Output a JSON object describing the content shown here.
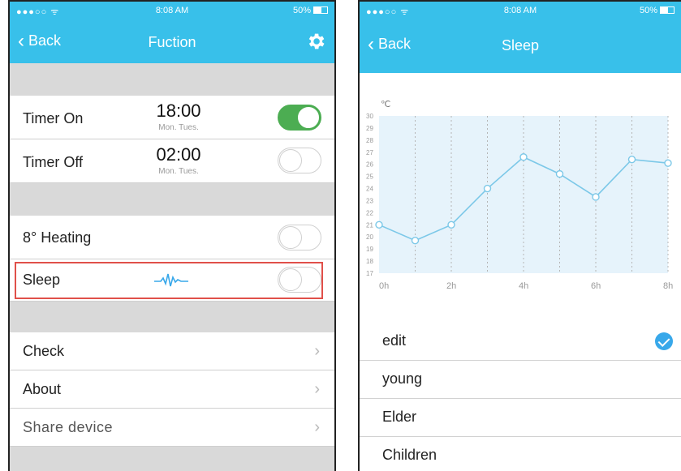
{
  "left_screen": {
    "status": {
      "signal": "●●●○○",
      "wifi": "ᯤ",
      "time": "8:08 AM",
      "battery": "50%"
    },
    "nav": {
      "back_label": "Back",
      "title": "Fuction",
      "settings_icon": "gear-icon"
    },
    "timer_on": {
      "label": "Timer On",
      "time": "18:00",
      "days": "Mon. Tues.",
      "enabled": true
    },
    "timer_off": {
      "label": "Timer Off",
      "time": "02:00",
      "days": "Mon. Tues.",
      "enabled": false
    },
    "heating": {
      "label": "8° Heating",
      "enabled": false
    },
    "sleep": {
      "label": "Sleep",
      "enabled": false,
      "wave_icon": "heartbeat-icon"
    },
    "menu": [
      {
        "label": "Check"
      },
      {
        "label": "About"
      },
      {
        "label": "Share device"
      }
    ]
  },
  "right_screen": {
    "status": {
      "signal": "●●●○○",
      "wifi": "ᯤ",
      "time": "8:08 AM",
      "battery": "50%"
    },
    "nav": {
      "back_label": "Back",
      "title": "Sleep"
    },
    "options": [
      {
        "label": "edit",
        "selected": true
      },
      {
        "label": "young",
        "selected": false
      },
      {
        "label": "Elder",
        "selected": false
      },
      {
        "label": "Children",
        "selected": false
      }
    ]
  },
  "chart_data": {
    "type": "line",
    "ylabel": "℃",
    "ylim": [
      17,
      30
    ],
    "yticks": [
      "30",
      "29",
      "28",
      "27",
      "26",
      "25",
      "24",
      "23",
      "22",
      "21",
      "20",
      "19",
      "18",
      "17"
    ],
    "x": [
      0,
      1,
      2,
      3,
      4,
      5,
      6,
      7,
      8
    ],
    "xticks": [
      "0h",
      "2h",
      "4h",
      "6h",
      "8h"
    ],
    "xtick_values": [
      0,
      2,
      4,
      6,
      8
    ],
    "values": [
      21,
      19.7,
      21,
      24,
      26.6,
      25.2,
      23.3,
      26.4,
      26.1
    ],
    "colors": {
      "line": "#7cc8e8",
      "fill": "#e6f3fb",
      "grid": "#b5b5b5"
    }
  }
}
